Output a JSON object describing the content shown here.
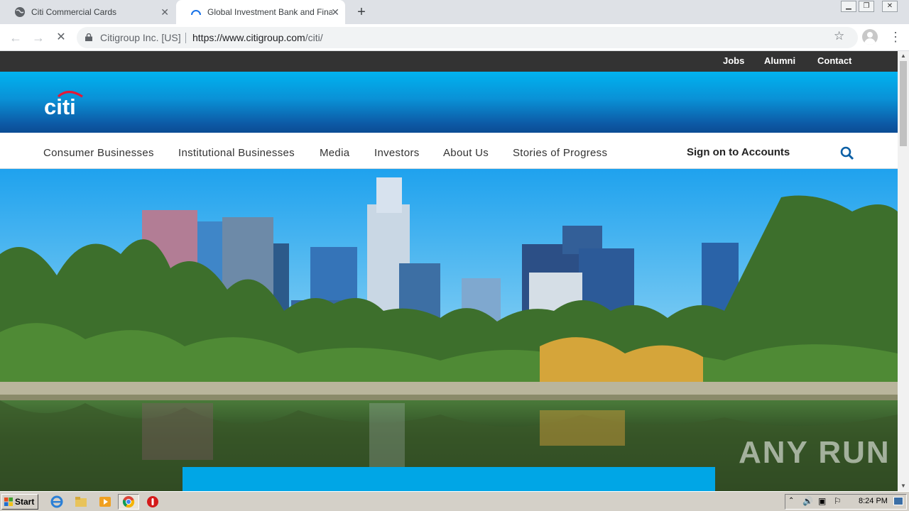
{
  "browser": {
    "tabs": [
      {
        "title": "Citi Commercial Cards",
        "active": false
      },
      {
        "title": "Global Investment Bank and Financial Services | Citi",
        "active": true
      }
    ],
    "omnibox": {
      "org": "Citigroup Inc. [US]",
      "url_host": "https://www.citigroup.com",
      "url_path": "/citi/"
    },
    "controls": {
      "back": "←",
      "forward": "→",
      "reload": "✕",
      "star": "☆",
      "menu": "⋮",
      "newtab": "+",
      "close": "✕"
    }
  },
  "site": {
    "utility_links": [
      "Jobs",
      "Alumni",
      "Contact"
    ],
    "logo_text": "citi",
    "nav": [
      "Consumer Businesses",
      "Institutional Businesses",
      "Media",
      "Investors",
      "About Us",
      "Stories of Progress"
    ],
    "sign_on": "Sign on to Accounts"
  },
  "watermark": "ANY RUN",
  "taskbar": {
    "start": "Start",
    "time": "8:24 PM"
  },
  "colors": {
    "utility_bg": "#333333",
    "brand_top": "#00b3f0",
    "brand_bottom": "#0b4c94",
    "citi_red": "#e31837",
    "search_blue": "#0b5fa5",
    "promo": "#00a6e6"
  }
}
